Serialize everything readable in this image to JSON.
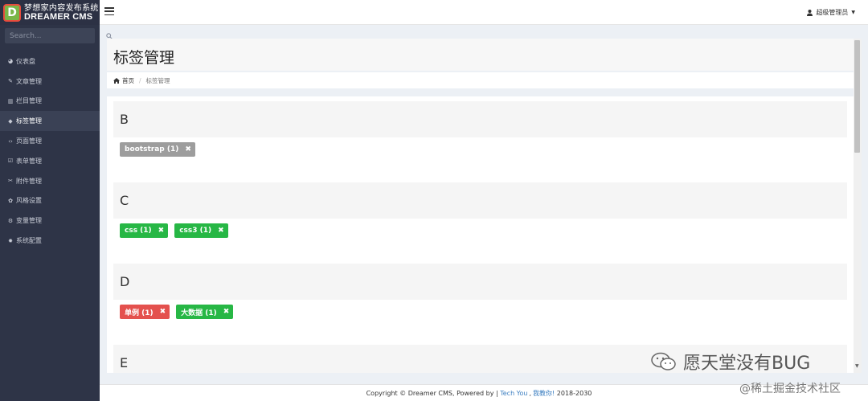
{
  "brand": {
    "logo_letter": "D",
    "title_cn": "梦想家内容发布系统",
    "title_en": "DREAMER CMS"
  },
  "search": {
    "placeholder": "Search..."
  },
  "sidebar": {
    "items": [
      {
        "label": "仪表盘",
        "icon": "dashboard-icon",
        "glyph": "◕"
      },
      {
        "label": "文章管理",
        "icon": "edit-icon",
        "glyph": "✎"
      },
      {
        "label": "栏目管理",
        "icon": "columns-icon",
        "glyph": "▥"
      },
      {
        "label": "标签管理",
        "icon": "tags-icon",
        "glyph": "◆",
        "active": true
      },
      {
        "label": "页面管理",
        "icon": "code-icon",
        "glyph": "‹›"
      },
      {
        "label": "表单管理",
        "icon": "checkbox-icon",
        "glyph": "☑"
      },
      {
        "label": "附件管理",
        "icon": "paperclip-icon",
        "glyph": "✂"
      },
      {
        "label": "风格设置",
        "icon": "palette-icon",
        "glyph": "✿"
      },
      {
        "label": "变量管理",
        "icon": "cogs-icon",
        "glyph": "⚙"
      },
      {
        "label": "系统配置",
        "icon": "gear-icon",
        "glyph": "✹"
      }
    ]
  },
  "topbar": {
    "user_label": "超级管理员",
    "user_icon": "user-icon",
    "caret": "▼"
  },
  "page": {
    "title": "标签管理",
    "breadcrumb": {
      "home": "首页",
      "current": "标签管理",
      "separator": "/"
    }
  },
  "tag_groups": [
    {
      "letter": "B",
      "tags": [
        {
          "text": "bootstrap (1)",
          "color": "#9d9d9d"
        }
      ]
    },
    {
      "letter": "C",
      "tags": [
        {
          "text": "css (1)",
          "color": "#27b745"
        },
        {
          "text": "css3 (1)",
          "color": "#27b745"
        }
      ]
    },
    {
      "letter": "D",
      "tags": [
        {
          "text": "单例 (1)",
          "color": "#e4514e"
        },
        {
          "text": "大数据 (1)",
          "color": "#27b745"
        }
      ]
    },
    {
      "letter": "E",
      "tags": []
    }
  ],
  "footer": {
    "prefix": "Copyright © Dreamer CMS, Powered by |",
    "link1": "Tech You",
    "sep": ",",
    "link2": "我教你!",
    "years": "2018-2030"
  },
  "watermark": {
    "line1": "愿天堂没有BUG",
    "line2": "@稀土掘金技术社区"
  },
  "colors": {
    "sidebar_bg": "#2e3447",
    "accent_green": "#27b745",
    "accent_red": "#e4514e",
    "accent_gray": "#9d9d9d",
    "link_blue": "#3c7fc1"
  }
}
